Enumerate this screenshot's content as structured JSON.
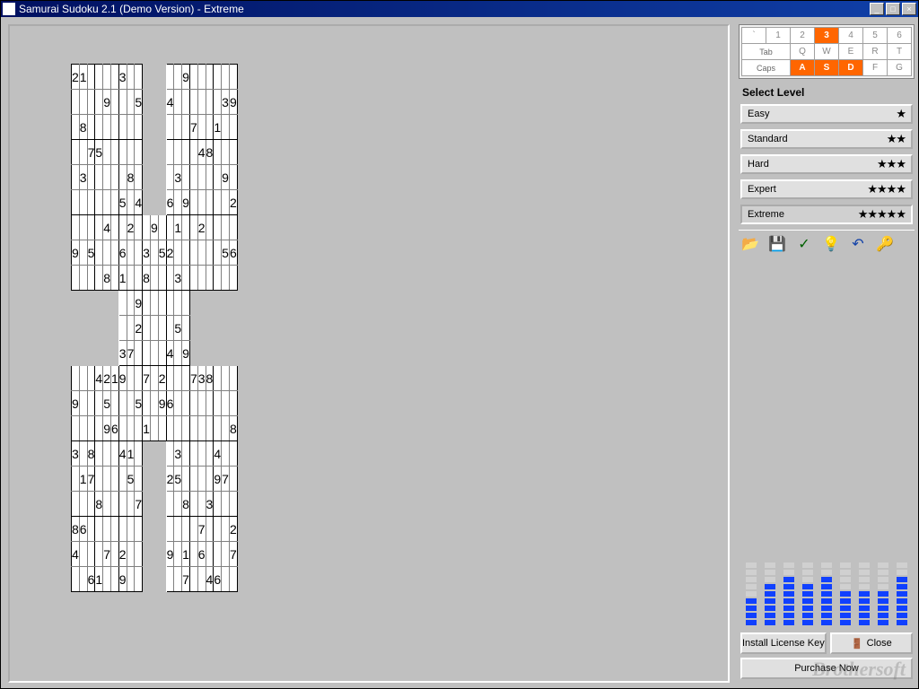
{
  "title": "Samurai Sudoku 2.1 (Demo Version) - Extreme",
  "window_buttons": {
    "min": "_",
    "max": "□",
    "close": "×"
  },
  "keyboard": {
    "row1": [
      "`",
      "1",
      "2",
      "3",
      "4",
      "5",
      "6"
    ],
    "row2": [
      "Tab",
      "Q",
      "W",
      "E",
      "R",
      "T"
    ],
    "row3": [
      "Caps",
      "A",
      "S",
      "D",
      "F",
      "G"
    ],
    "highlighted": [
      "3",
      "A",
      "S",
      "D"
    ]
  },
  "select_level_label": "Select Level",
  "levels": [
    {
      "name": "Easy",
      "stars": 1,
      "selected": false
    },
    {
      "name": "Standard",
      "stars": 2,
      "selected": false
    },
    {
      "name": "Hard",
      "stars": 3,
      "selected": false
    },
    {
      "name": "Expert",
      "stars": 4,
      "selected": false
    },
    {
      "name": "Extreme",
      "stars": 5,
      "selected": true
    }
  ],
  "toolbar": {
    "open": "📂",
    "save": "💾",
    "check": "✓",
    "hint": "💡",
    "undo": "↶",
    "key": "🔑"
  },
  "digit_usage": [
    4,
    6,
    7,
    6,
    7,
    5,
    5,
    5,
    7
  ],
  "buttons": {
    "install": "Install License Key",
    "close": "Close",
    "purchase": "Purchase Now"
  },
  "watermark": "Brothersoft",
  "samurai_grid": {
    "rows": 21,
    "cols": 21,
    "cells": {
      "0,0": "2",
      "0,1": "1",
      "0,6": "3",
      "0,14": "9",
      "1,4": "9",
      "1,8": "5",
      "1,12": "4",
      "1,19": "3",
      "1,20": "9",
      "2,1": "8",
      "2,15": "7",
      "2,18": "1",
      "3,2": "7",
      "3,3": "5",
      "3,16": "4",
      "3,17": "8",
      "4,1": "3",
      "4,7": "8",
      "4,13": "3",
      "4,19": "9",
      "5,6": "5",
      "5,8": "4",
      "5,12": "6",
      "5,14": "9",
      "5,20": "2",
      "6,4": "4",
      "6,7": "2",
      "6,10": "9",
      "6,13": "1",
      "6,16": "2",
      "7,0": "9",
      "7,2": "5",
      "7,6": "6",
      "7,9": "3",
      "7,11": "5",
      "7,12": "2",
      "7,19": "5",
      "7,20": "6",
      "8,4": "8",
      "8,6": "1",
      "8,9": "8",
      "8,13": "3",
      "9,8": "9",
      "10,8": "2",
      "10,13": "5",
      "11,6": "3",
      "11,7": "7",
      "11,12": "4",
      "11,14": "9",
      "12,3": "4",
      "12,4": "2",
      "12,5": "1",
      "12,6": "9",
      "12,9": "7",
      "12,11": "2",
      "12,15": "7",
      "12,16": "3",
      "12,17": "8",
      "13,0": "9",
      "13,4": "5",
      "13,8": "5",
      "13,11": "9",
      "13,12": "6",
      "14,4": "9",
      "14,5": "6",
      "14,9": "1",
      "14,20": "8",
      "15,0": "3",
      "15,2": "8",
      "15,6": "4",
      "15,7": "1",
      "15,13": "3",
      "15,18": "4",
      "16,1": "1",
      "16,2": "7",
      "16,7": "5",
      "16,12": "2",
      "16,13": "5",
      "16,18": "9",
      "16,19": "7",
      "17,3": "8",
      "17,8": "7",
      "17,14": "8",
      "17,17": "3",
      "18,0": "8",
      "18,1": "6",
      "18,16": "7",
      "18,20": "2",
      "19,0": "4",
      "19,4": "7",
      "19,6": "2",
      "19,12": "9",
      "19,14": "1",
      "19,16": "6",
      "19,20": "7",
      "20,2": "6",
      "20,3": "1",
      "20,6": "9",
      "20,14": "7",
      "20,17": "4",
      "20,18": "6"
    }
  }
}
